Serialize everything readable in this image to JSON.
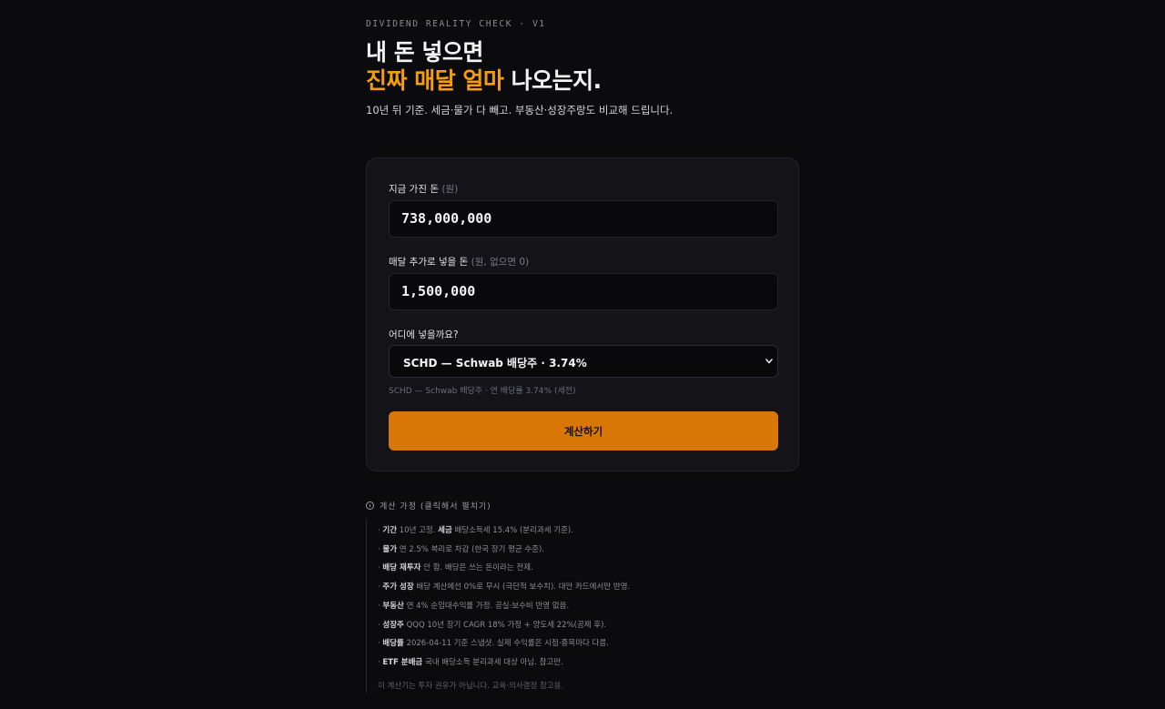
{
  "header": {
    "eyebrow": "DIVIDEND REALITY CHECK · V1",
    "headline_line1": "내 돈 넣으면",
    "headline_accent": "진짜 매달 얼마",
    "headline_rest": " 나오는지.",
    "subtitle": "10년 뒤 기준. 세금·물가 다 빼고. 부동산·성장주랑도 비교해 드립니다."
  },
  "form": {
    "principal_label": "지금 가진 돈",
    "principal_hint": "(원)",
    "principal_value": "738,000,000",
    "monthly_label": "매달 추가로 넣을 돈",
    "monthly_hint": "(원, 없으면 0)",
    "monthly_value": "1,500,000",
    "asset_label": "어디에 넣을까요?",
    "asset_selected": "SCHD — Schwab 배당주 · 3.74%",
    "asset_note": "SCHD — Schwab 배당주 · 연 배당률 3.74% (세전)",
    "submit_label": "계산하기"
  },
  "assumptions": {
    "toggle_label": "계산 가정 (클릭해서 펼치기)",
    "items": [
      {
        "bold": "기간",
        "text": " 10년 고정. ",
        "bold2": "세금",
        "text2": " 배당소득세 15.4% (분리과세 기준)."
      },
      {
        "bold": "물가",
        "text": " 연 2.5% 복리로 차감 (한국 장기 평균 수준)."
      },
      {
        "bold": "배당 재투자",
        "text": " 안 함. 배당은 쓰는 돈이라는 전제."
      },
      {
        "bold": "주가 성장",
        "text": " 배당 계산에선 0%로 무시 (극단적 보수치). 대안 카드에서만 반영."
      },
      {
        "bold": "부동산",
        "text": " 연 4% 순임대수익률 가정. 공실·보수비 반영 없음."
      },
      {
        "bold": "성장주",
        "text": " QQQ 10년 장기 CAGR 18% 가정 + 양도세 22%(공제 후)."
      },
      {
        "bold": "배당률",
        "text": " 2026-04-11 기준 스냅샷. 실제 수익률은 시점·종목마다 다름."
      },
      {
        "bold": "ETF 분배금",
        "text": " 국내 배당소득 분리과세 대상 아님. 참고만."
      }
    ],
    "disclaimer": "이 계산기는 투자 권유가 아닙니다. 교육·의사결정 참고용."
  }
}
